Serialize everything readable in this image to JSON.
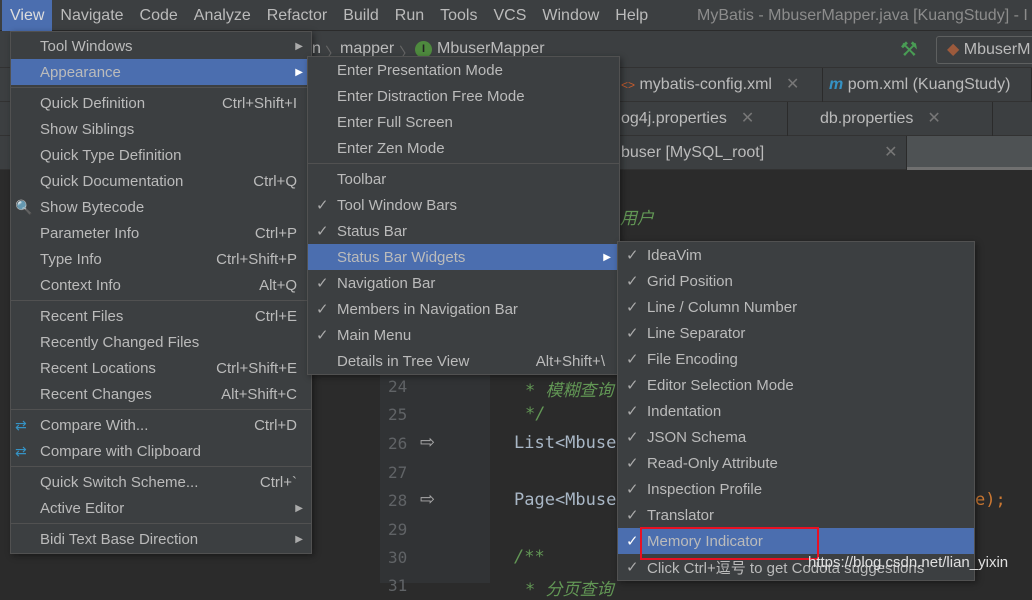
{
  "menubar": {
    "items": [
      "View",
      "Navigate",
      "Code",
      "Analyze",
      "Refactor",
      "Build",
      "Run",
      "Tools",
      "VCS",
      "Window",
      "Help"
    ],
    "active": "View"
  },
  "window_title": "MyBatis - MbuserMapper.java [KuangStudy] - I",
  "breadcrumb": {
    "items": [
      "n",
      "mapper",
      "MbuserMapper"
    ]
  },
  "run_config": "MbuserM",
  "tabs": {
    "row1": [
      {
        "label": "mybatis-config.xml"
      },
      {
        "label": "pom.xml (KuangStudy)"
      }
    ],
    "row2": [
      {
        "label": "og4j.properties"
      },
      {
        "label": "db.properties"
      }
    ],
    "row3": [
      {
        "label": "buser [MySQL_root]"
      }
    ]
  },
  "editor": {
    "line_numbers": [
      "24",
      "25",
      "26",
      "27",
      "28",
      "29",
      "30",
      "31"
    ],
    "lines": {
      "l22": "用户",
      "l24": "* 模糊查询",
      "l25": "*/",
      "l26": "List<Mbuse",
      "l28": "Page<Mbuse",
      "l28b": "e);",
      "l30": "/**",
      "l31": "* 分页查询"
    }
  },
  "view_menu": {
    "items": [
      {
        "label": "Tool Windows",
        "submenu": true
      },
      {
        "label": "Appearance",
        "submenu": true,
        "selected": true
      },
      {
        "sep": true
      },
      {
        "label": "Quick Definition",
        "shortcut": "Ctrl+Shift+I"
      },
      {
        "label": "Show Siblings"
      },
      {
        "label": "Quick Type Definition"
      },
      {
        "label": "Quick Documentation",
        "shortcut": "Ctrl+Q"
      },
      {
        "label": "Show Bytecode",
        "icon": "bytecode-icon"
      },
      {
        "label": "Parameter Info",
        "shortcut": "Ctrl+P"
      },
      {
        "label": "Type Info",
        "shortcut": "Ctrl+Shift+P"
      },
      {
        "label": "Context Info",
        "shortcut": "Alt+Q"
      },
      {
        "sep": true
      },
      {
        "label": "Recent Files",
        "shortcut": "Ctrl+E"
      },
      {
        "label": "Recently Changed Files"
      },
      {
        "label": "Recent Locations",
        "shortcut": "Ctrl+Shift+E"
      },
      {
        "label": "Recent Changes",
        "shortcut": "Alt+Shift+C"
      },
      {
        "sep": true
      },
      {
        "label": "Compare With...",
        "shortcut": "Ctrl+D",
        "icon": "compare-icon"
      },
      {
        "label": "Compare with Clipboard",
        "icon": "compare-clipboard-icon"
      },
      {
        "sep": true
      },
      {
        "label": "Quick Switch Scheme...",
        "shortcut": "Ctrl+`"
      },
      {
        "label": "Active Editor",
        "submenu": true
      },
      {
        "sep": true
      },
      {
        "label": "Bidi Text Base Direction",
        "submenu": true
      }
    ]
  },
  "appearance_menu": {
    "items": [
      {
        "label": "Enter Presentation Mode"
      },
      {
        "label": "Enter Distraction Free Mode"
      },
      {
        "label": "Enter Full Screen"
      },
      {
        "label": "Enter Zen Mode"
      },
      {
        "sep": true
      },
      {
        "label": "Toolbar",
        "checked": false
      },
      {
        "label": "Tool Window Bars",
        "checked": true
      },
      {
        "label": "Status Bar",
        "checked": true
      },
      {
        "label": "Status Bar Widgets",
        "submenu": true,
        "selected": true
      },
      {
        "label": "Navigation Bar",
        "checked": true
      },
      {
        "label": "Members in Navigation Bar",
        "checked": true
      },
      {
        "label": "Main Menu",
        "checked": true
      },
      {
        "label": "Details in Tree View",
        "shortcut": "Alt+Shift+\\"
      }
    ]
  },
  "widgets_menu": {
    "items": [
      {
        "label": "IdeaVim",
        "checked": true
      },
      {
        "label": "Grid Position",
        "checked": true
      },
      {
        "label": "Line / Column Number",
        "checked": true
      },
      {
        "label": "Line Separator",
        "checked": true
      },
      {
        "label": "File Encoding",
        "checked": true
      },
      {
        "label": "Editor Selection Mode",
        "checked": true
      },
      {
        "label": "Indentation",
        "checked": true
      },
      {
        "label": "JSON Schema",
        "checked": true
      },
      {
        "label": "Read-Only Attribute",
        "checked": true
      },
      {
        "label": "Inspection Profile",
        "checked": true
      },
      {
        "label": "Translator",
        "checked": true
      },
      {
        "label": "Memory Indicator",
        "checked": true,
        "selected": true,
        "highlighted_box": true
      },
      {
        "label": "Click Ctrl+逗号 to get Codota suggestions",
        "checked": true
      }
    ]
  },
  "watermark": "https://blog.csdn.net/lian_yixin",
  "colors": {
    "selection": "#4b6eaf",
    "menu_bg": "#3c3f41",
    "editor_bg": "#2b2b2b",
    "highlight_box": "#e81123"
  }
}
